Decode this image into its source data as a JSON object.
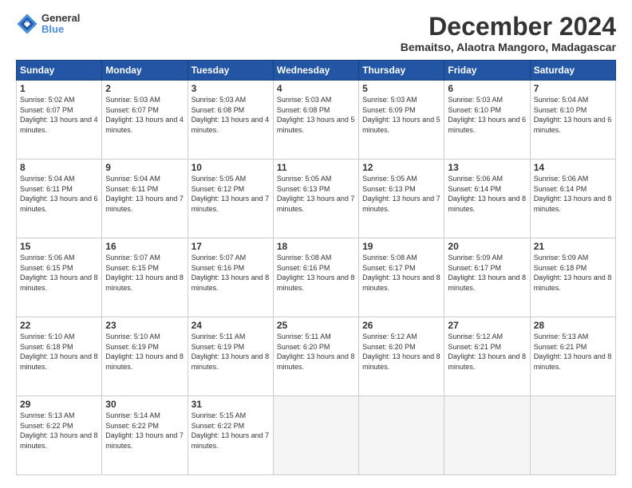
{
  "logo": {
    "line1": "General",
    "line2": "Blue"
  },
  "title": "December 2024",
  "subtitle": "Bemaitso, Alaotra Mangoro, Madagascar",
  "days_header": [
    "Sunday",
    "Monday",
    "Tuesday",
    "Wednesday",
    "Thursday",
    "Friday",
    "Saturday"
  ],
  "weeks": [
    [
      {
        "day": "1",
        "rise": "5:02 AM",
        "set": "6:07 PM",
        "daylight": "13 hours and 4 minutes."
      },
      {
        "day": "2",
        "rise": "5:03 AM",
        "set": "6:07 PM",
        "daylight": "13 hours and 4 minutes."
      },
      {
        "day": "3",
        "rise": "5:03 AM",
        "set": "6:08 PM",
        "daylight": "13 hours and 4 minutes."
      },
      {
        "day": "4",
        "rise": "5:03 AM",
        "set": "6:08 PM",
        "daylight": "13 hours and 5 minutes."
      },
      {
        "day": "5",
        "rise": "5:03 AM",
        "set": "6:09 PM",
        "daylight": "13 hours and 5 minutes."
      },
      {
        "day": "6",
        "rise": "5:03 AM",
        "set": "6:10 PM",
        "daylight": "13 hours and 6 minutes."
      },
      {
        "day": "7",
        "rise": "5:04 AM",
        "set": "6:10 PM",
        "daylight": "13 hours and 6 minutes."
      }
    ],
    [
      {
        "day": "8",
        "rise": "5:04 AM",
        "set": "6:11 PM",
        "daylight": "13 hours and 6 minutes."
      },
      {
        "day": "9",
        "rise": "5:04 AM",
        "set": "6:11 PM",
        "daylight": "13 hours and 7 minutes."
      },
      {
        "day": "10",
        "rise": "5:05 AM",
        "set": "6:12 PM",
        "daylight": "13 hours and 7 minutes."
      },
      {
        "day": "11",
        "rise": "5:05 AM",
        "set": "6:13 PM",
        "daylight": "13 hours and 7 minutes."
      },
      {
        "day": "12",
        "rise": "5:05 AM",
        "set": "6:13 PM",
        "daylight": "13 hours and 7 minutes."
      },
      {
        "day": "13",
        "rise": "5:06 AM",
        "set": "6:14 PM",
        "daylight": "13 hours and 8 minutes."
      },
      {
        "day": "14",
        "rise": "5:06 AM",
        "set": "6:14 PM",
        "daylight": "13 hours and 8 minutes."
      }
    ],
    [
      {
        "day": "15",
        "rise": "5:06 AM",
        "set": "6:15 PM",
        "daylight": "13 hours and 8 minutes."
      },
      {
        "day": "16",
        "rise": "5:07 AM",
        "set": "6:15 PM",
        "daylight": "13 hours and 8 minutes."
      },
      {
        "day": "17",
        "rise": "5:07 AM",
        "set": "6:16 PM",
        "daylight": "13 hours and 8 minutes."
      },
      {
        "day": "18",
        "rise": "5:08 AM",
        "set": "6:16 PM",
        "daylight": "13 hours and 8 minutes."
      },
      {
        "day": "19",
        "rise": "5:08 AM",
        "set": "6:17 PM",
        "daylight": "13 hours and 8 minutes."
      },
      {
        "day": "20",
        "rise": "5:09 AM",
        "set": "6:17 PM",
        "daylight": "13 hours and 8 minutes."
      },
      {
        "day": "21",
        "rise": "5:09 AM",
        "set": "6:18 PM",
        "daylight": "13 hours and 8 minutes."
      }
    ],
    [
      {
        "day": "22",
        "rise": "5:10 AM",
        "set": "6:18 PM",
        "daylight": "13 hours and 8 minutes."
      },
      {
        "day": "23",
        "rise": "5:10 AM",
        "set": "6:19 PM",
        "daylight": "13 hours and 8 minutes."
      },
      {
        "day": "24",
        "rise": "5:11 AM",
        "set": "6:19 PM",
        "daylight": "13 hours and 8 minutes."
      },
      {
        "day": "25",
        "rise": "5:11 AM",
        "set": "6:20 PM",
        "daylight": "13 hours and 8 minutes."
      },
      {
        "day": "26",
        "rise": "5:12 AM",
        "set": "6:20 PM",
        "daylight": "13 hours and 8 minutes."
      },
      {
        "day": "27",
        "rise": "5:12 AM",
        "set": "6:21 PM",
        "daylight": "13 hours and 8 minutes."
      },
      {
        "day": "28",
        "rise": "5:13 AM",
        "set": "6:21 PM",
        "daylight": "13 hours and 8 minutes."
      }
    ],
    [
      {
        "day": "29",
        "rise": "5:13 AM",
        "set": "6:22 PM",
        "daylight": "13 hours and 8 minutes."
      },
      {
        "day": "30",
        "rise": "5:14 AM",
        "set": "6:22 PM",
        "daylight": "13 hours and 7 minutes."
      },
      {
        "day": "31",
        "rise": "5:15 AM",
        "set": "6:22 PM",
        "daylight": "13 hours and 7 minutes."
      },
      null,
      null,
      null,
      null
    ]
  ]
}
